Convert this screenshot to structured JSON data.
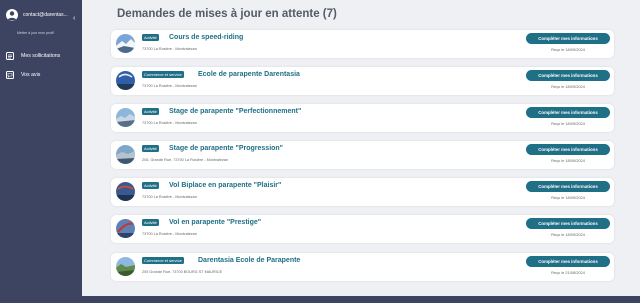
{
  "sidebar": {
    "email": "contact@darentas...",
    "profile_link": "Mettre à jour mon profil",
    "items": [
      {
        "label": "Mes sollicitations",
        "icon": "clipboard-icon"
      },
      {
        "label": "Vos avis",
        "icon": "comment-icon"
      }
    ]
  },
  "main": {
    "title": "Demandes de mises à jour en attente (7)",
    "button_label": "Compléter mes informations",
    "cards": [
      {
        "badge": "Activité",
        "title": "Cours de speed-riding",
        "address": "73700 La Rosière - Montvalezan",
        "received": "Reçu le 18/09/2024"
      },
      {
        "badge": "Commerce et service",
        "title": "Ecole de parapente Darentasia",
        "address": "73700 La Rosière - Montvalezan",
        "received": "Reçu le 18/09/2024"
      },
      {
        "badge": "Activité",
        "title": "Stage de parapente \"Perfectionnement\"",
        "address": "73700 La Rosière - Montvalezan",
        "received": "Reçu le 18/09/2024"
      },
      {
        "badge": "Activité",
        "title": "Stage de parapente \"Progression\"",
        "address": "205, Grande Rue, 73700 La Rosière - Montvalezan",
        "received": "Reçu le 18/09/2024"
      },
      {
        "badge": "Activité",
        "title": "Vol Biplace en parapente \"Plaisir\"",
        "address": "73700 La Rosière - Montvalezan",
        "received": "Reçu le 18/09/2024"
      },
      {
        "badge": "Activité",
        "title": "Vol en parapente \"Prestige\"",
        "address": "73700 La Rosière - Montvalezan",
        "received": "Reçu le 18/09/2024"
      },
      {
        "badge": "Commerce et service",
        "title": "Darentasia Ecole de Parapente",
        "address": "205 Grande Rue, 73700 BOURG ST MAURICE",
        "received": "Reçu le 21/08/2024"
      }
    ]
  },
  "colors": {
    "sidebar": "#3d4461",
    "accent": "#1f6f86",
    "background": "#eef0f3"
  }
}
